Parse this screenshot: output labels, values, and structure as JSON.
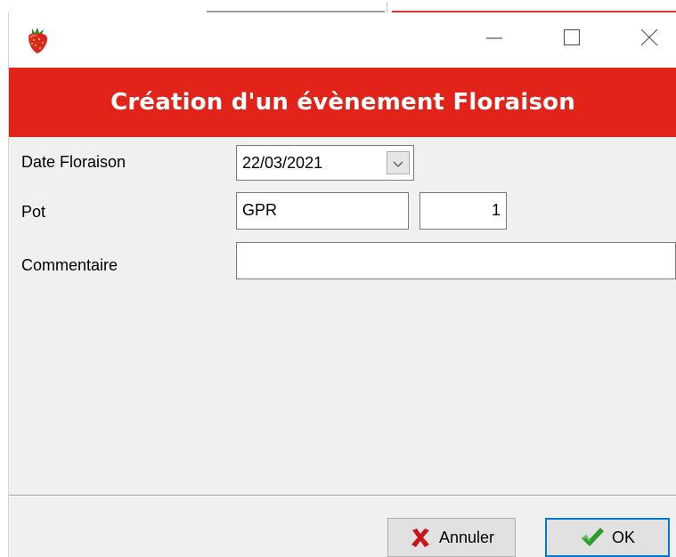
{
  "dialog": {
    "title_bar": {
      "app_icon": "strawberry-icon",
      "minimize_icon": "minimize-icon",
      "maximize_icon": "maximize-icon",
      "close_icon": "close-icon"
    },
    "banner_title": "Création d'un évènement Floraison",
    "banner_color": "#e2231a",
    "fields": {
      "date": {
        "label": "Date Floraison",
        "value": "22/03/2021",
        "dropdown_icon": "chevron-down-icon"
      },
      "pot": {
        "label": "Pot",
        "code_value": "GPR",
        "number_value": "1"
      },
      "comment": {
        "label": "Commentaire",
        "value": ""
      }
    },
    "buttons": {
      "cancel": {
        "label": "Annuler",
        "icon": "red-x-icon"
      },
      "ok": {
        "label": "OK",
        "icon": "green-check-icon"
      }
    }
  }
}
